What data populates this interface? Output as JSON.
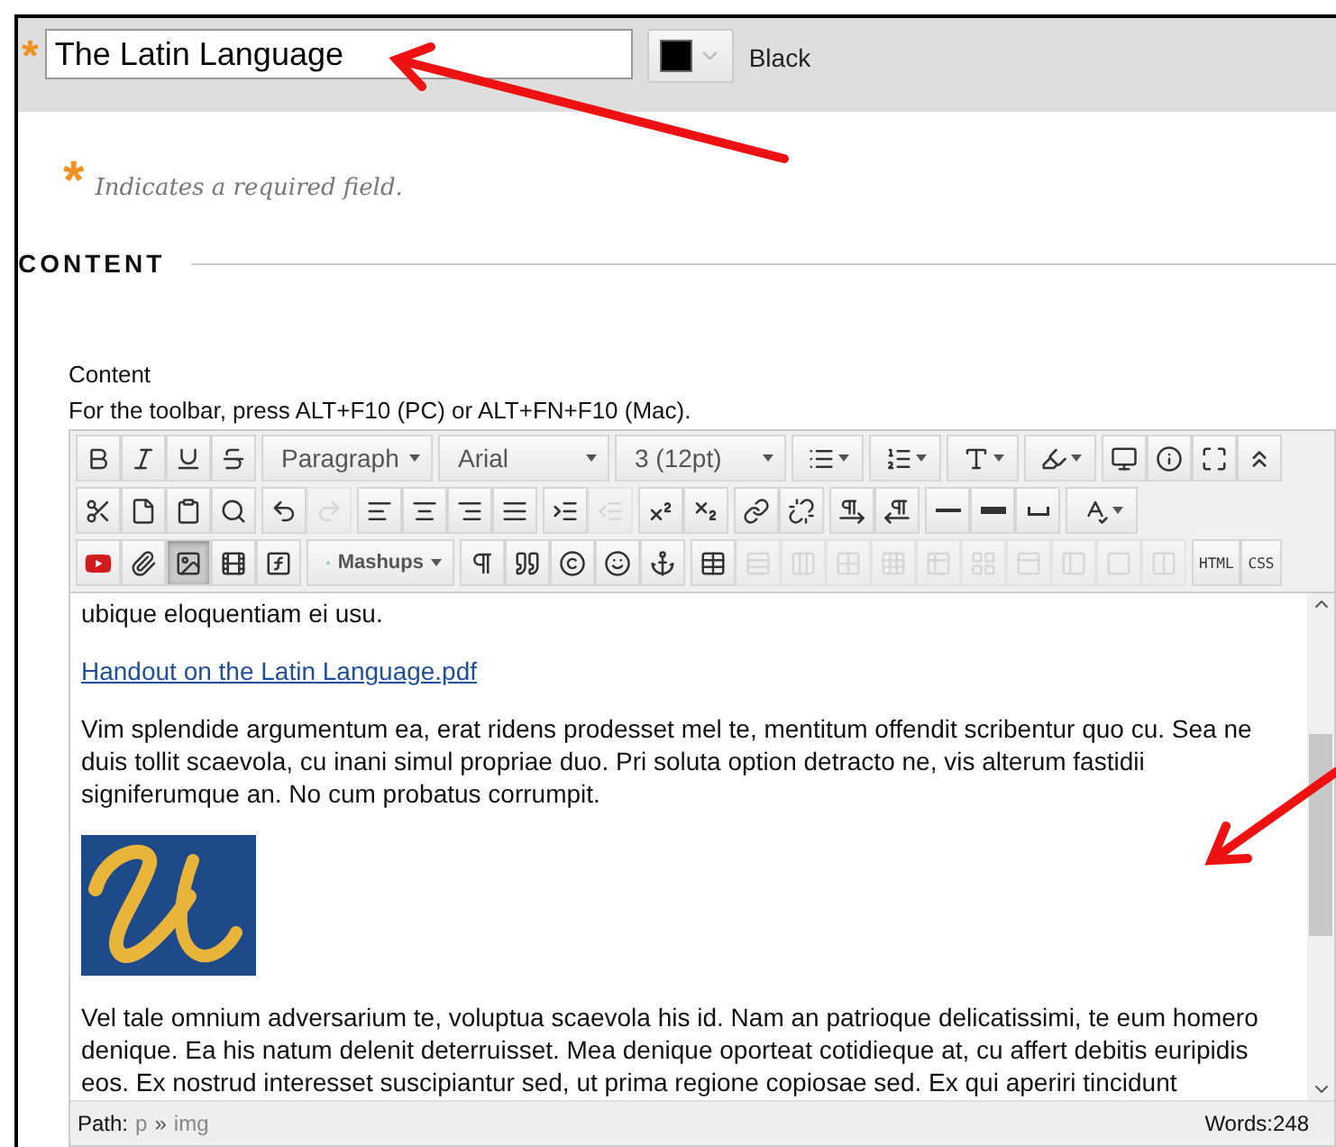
{
  "title_field": {
    "required_mark": "*",
    "value": "The Latin Language"
  },
  "color_picker": {
    "color": "#000000",
    "label": "Black"
  },
  "required_note": {
    "mark": "*",
    "text": "Indicates a required field."
  },
  "section_heading": "CONTENT",
  "editor": {
    "label": "Content",
    "hint": "For the toolbar, press ALT+F10 (PC) or ALT+FN+F10 (Mac).",
    "toolbar": [
      [
        [
          {
            "kind": "icon",
            "disabled": false,
            "active": false
          },
          {
            "kind": "icon",
            "disabled": false,
            "active": false
          },
          {
            "kind": "icon",
            "disabled": false,
            "active": false
          },
          {
            "kind": "icon",
            "disabled": false,
            "active": false
          }
        ],
        [
          {
            "kind": "select",
            "label": "Paragraph"
          }
        ],
        [
          {
            "kind": "select",
            "label": "Arial"
          }
        ],
        [
          {
            "kind": "select",
            "label": "3 (12pt)"
          }
        ],
        [
          {
            "kind": "split",
            "disabled": false,
            "active": false
          }
        ],
        [
          {
            "kind": "split",
            "disabled": false,
            "active": false
          }
        ],
        [
          {
            "kind": "split",
            "disabled": false,
            "active": false
          }
        ],
        [
          {
            "kind": "split",
            "disabled": false,
            "active": false
          }
        ],
        [
          {
            "kind": "icon",
            "disabled": false,
            "active": false
          },
          {
            "kind": "icon",
            "disabled": false,
            "active": false
          },
          {
            "kind": "icon",
            "disabled": false,
            "active": false
          },
          {
            "kind": "icon",
            "disabled": false,
            "active": false
          }
        ]
      ],
      [
        [
          {
            "kind": "icon",
            "disabled": false,
            "active": false
          },
          {
            "kind": "icon",
            "disabled": false,
            "active": false
          },
          {
            "kind": "icon",
            "disabled": false,
            "active": false
          },
          {
            "kind": "icon",
            "disabled": false,
            "active": false
          }
        ],
        [
          {
            "kind": "icon",
            "disabled": false,
            "active": false
          },
          {
            "kind": "icon",
            "disabled": true,
            "active": false
          }
        ],
        [
          {
            "kind": "icon",
            "disabled": false,
            "active": false
          },
          {
            "kind": "icon",
            "disabled": false,
            "active": false
          },
          {
            "kind": "icon",
            "disabled": false,
            "active": false
          },
          {
            "kind": "icon",
            "disabled": false,
            "active": false
          }
        ],
        [
          {
            "kind": "icon",
            "disabled": false,
            "active": false
          },
          {
            "kind": "icon",
            "disabled": true,
            "active": false
          }
        ],
        [
          {
            "kind": "icon",
            "disabled": false,
            "active": false
          },
          {
            "kind": "icon",
            "disabled": false,
            "active": false
          }
        ],
        [
          {
            "kind": "icon",
            "disabled": false,
            "active": false
          },
          {
            "kind": "icon",
            "disabled": false,
            "active": false
          }
        ],
        [
          {
            "kind": "icon",
            "disabled": false,
            "active": false
          },
          {
            "kind": "icon",
            "disabled": false,
            "active": false
          }
        ],
        [
          {
            "kind": "icon",
            "disabled": false,
            "active": false
          },
          {
            "kind": "icon",
            "disabled": false,
            "active": false
          },
          {
            "kind": "icon",
            "disabled": false,
            "active": false
          }
        ],
        [
          {
            "kind": "split",
            "disabled": false,
            "active": false
          }
        ]
      ],
      [
        [
          {
            "kind": "icon",
            "disabled": false,
            "active": false
          },
          {
            "kind": "icon",
            "disabled": false,
            "active": false
          },
          {
            "kind": "icon",
            "disabled": false,
            "active": true
          },
          {
            "kind": "icon",
            "disabled": false,
            "active": false
          },
          {
            "kind": "icon",
            "disabled": false,
            "active": false
          }
        ],
        [
          {
            "kind": "select",
            "label": "Mashups"
          }
        ],
        [
          {
            "kind": "icon",
            "disabled": false,
            "active": false
          },
          {
            "kind": "icon",
            "disabled": false,
            "active": false
          },
          {
            "kind": "icon",
            "disabled": false,
            "active": false
          },
          {
            "kind": "icon",
            "disabled": false,
            "active": false
          },
          {
            "kind": "icon",
            "disabled": false,
            "active": false
          }
        ],
        [
          {
            "kind": "icon",
            "disabled": false,
            "active": false
          },
          {
            "kind": "icon",
            "disabled": true,
            "active": false
          },
          {
            "kind": "icon",
            "disabled": true,
            "active": false
          },
          {
            "kind": "icon",
            "disabled": true,
            "active": false
          },
          {
            "kind": "icon",
            "disabled": true,
            "active": false
          },
          {
            "kind": "icon",
            "disabled": true,
            "active": false
          },
          {
            "kind": "icon",
            "disabled": true,
            "active": false
          },
          {
            "kind": "icon",
            "disabled": true,
            "active": false
          },
          {
            "kind": "icon",
            "disabled": true,
            "active": false
          },
          {
            "kind": "icon",
            "disabled": true,
            "active": false
          },
          {
            "kind": "icon",
            "disabled": true,
            "active": false
          }
        ],
        [
          {
            "kind": "text",
            "label": "HTML"
          },
          {
            "kind": "text",
            "label": "CSS"
          }
        ]
      ]
    ],
    "body": [
      {
        "kind": "text",
        "text": "ubique eloquentiam ei usu."
      },
      {
        "kind": "link",
        "text": "Handout on the Latin Language.pdf"
      },
      {
        "kind": "text",
        "text": "Vim splendide argumentum ea, erat ridens prodesset mel te, mentitum offendit scribentur quo cu. Sea ne duis tollit scaevola, cu inani simul propriae duo. Pri soluta option detracto ne, vis alterum fastidii signiferumque an. No cum probatus corrumpit."
      },
      {
        "kind": "picture"
      },
      {
        "kind": "text",
        "text": "Vel tale omnium adversarium te, voluptua scaevola his id. Nam an patrioque delicatissimi, te eum homero denique. Ea his natum delenit deterruisset. Mea denique oporteat cotidieque at, cu affert debitis euripidis eos. Ex nostrud interesset suscipiantur sed, ut prima regione copiosae sed. Ex qui aperiri tincidunt"
      }
    ],
    "status": {
      "path_label": "Path:",
      "path": [
        "p",
        "img"
      ],
      "path_separator": "»",
      "words": "Words:248"
    }
  }
}
